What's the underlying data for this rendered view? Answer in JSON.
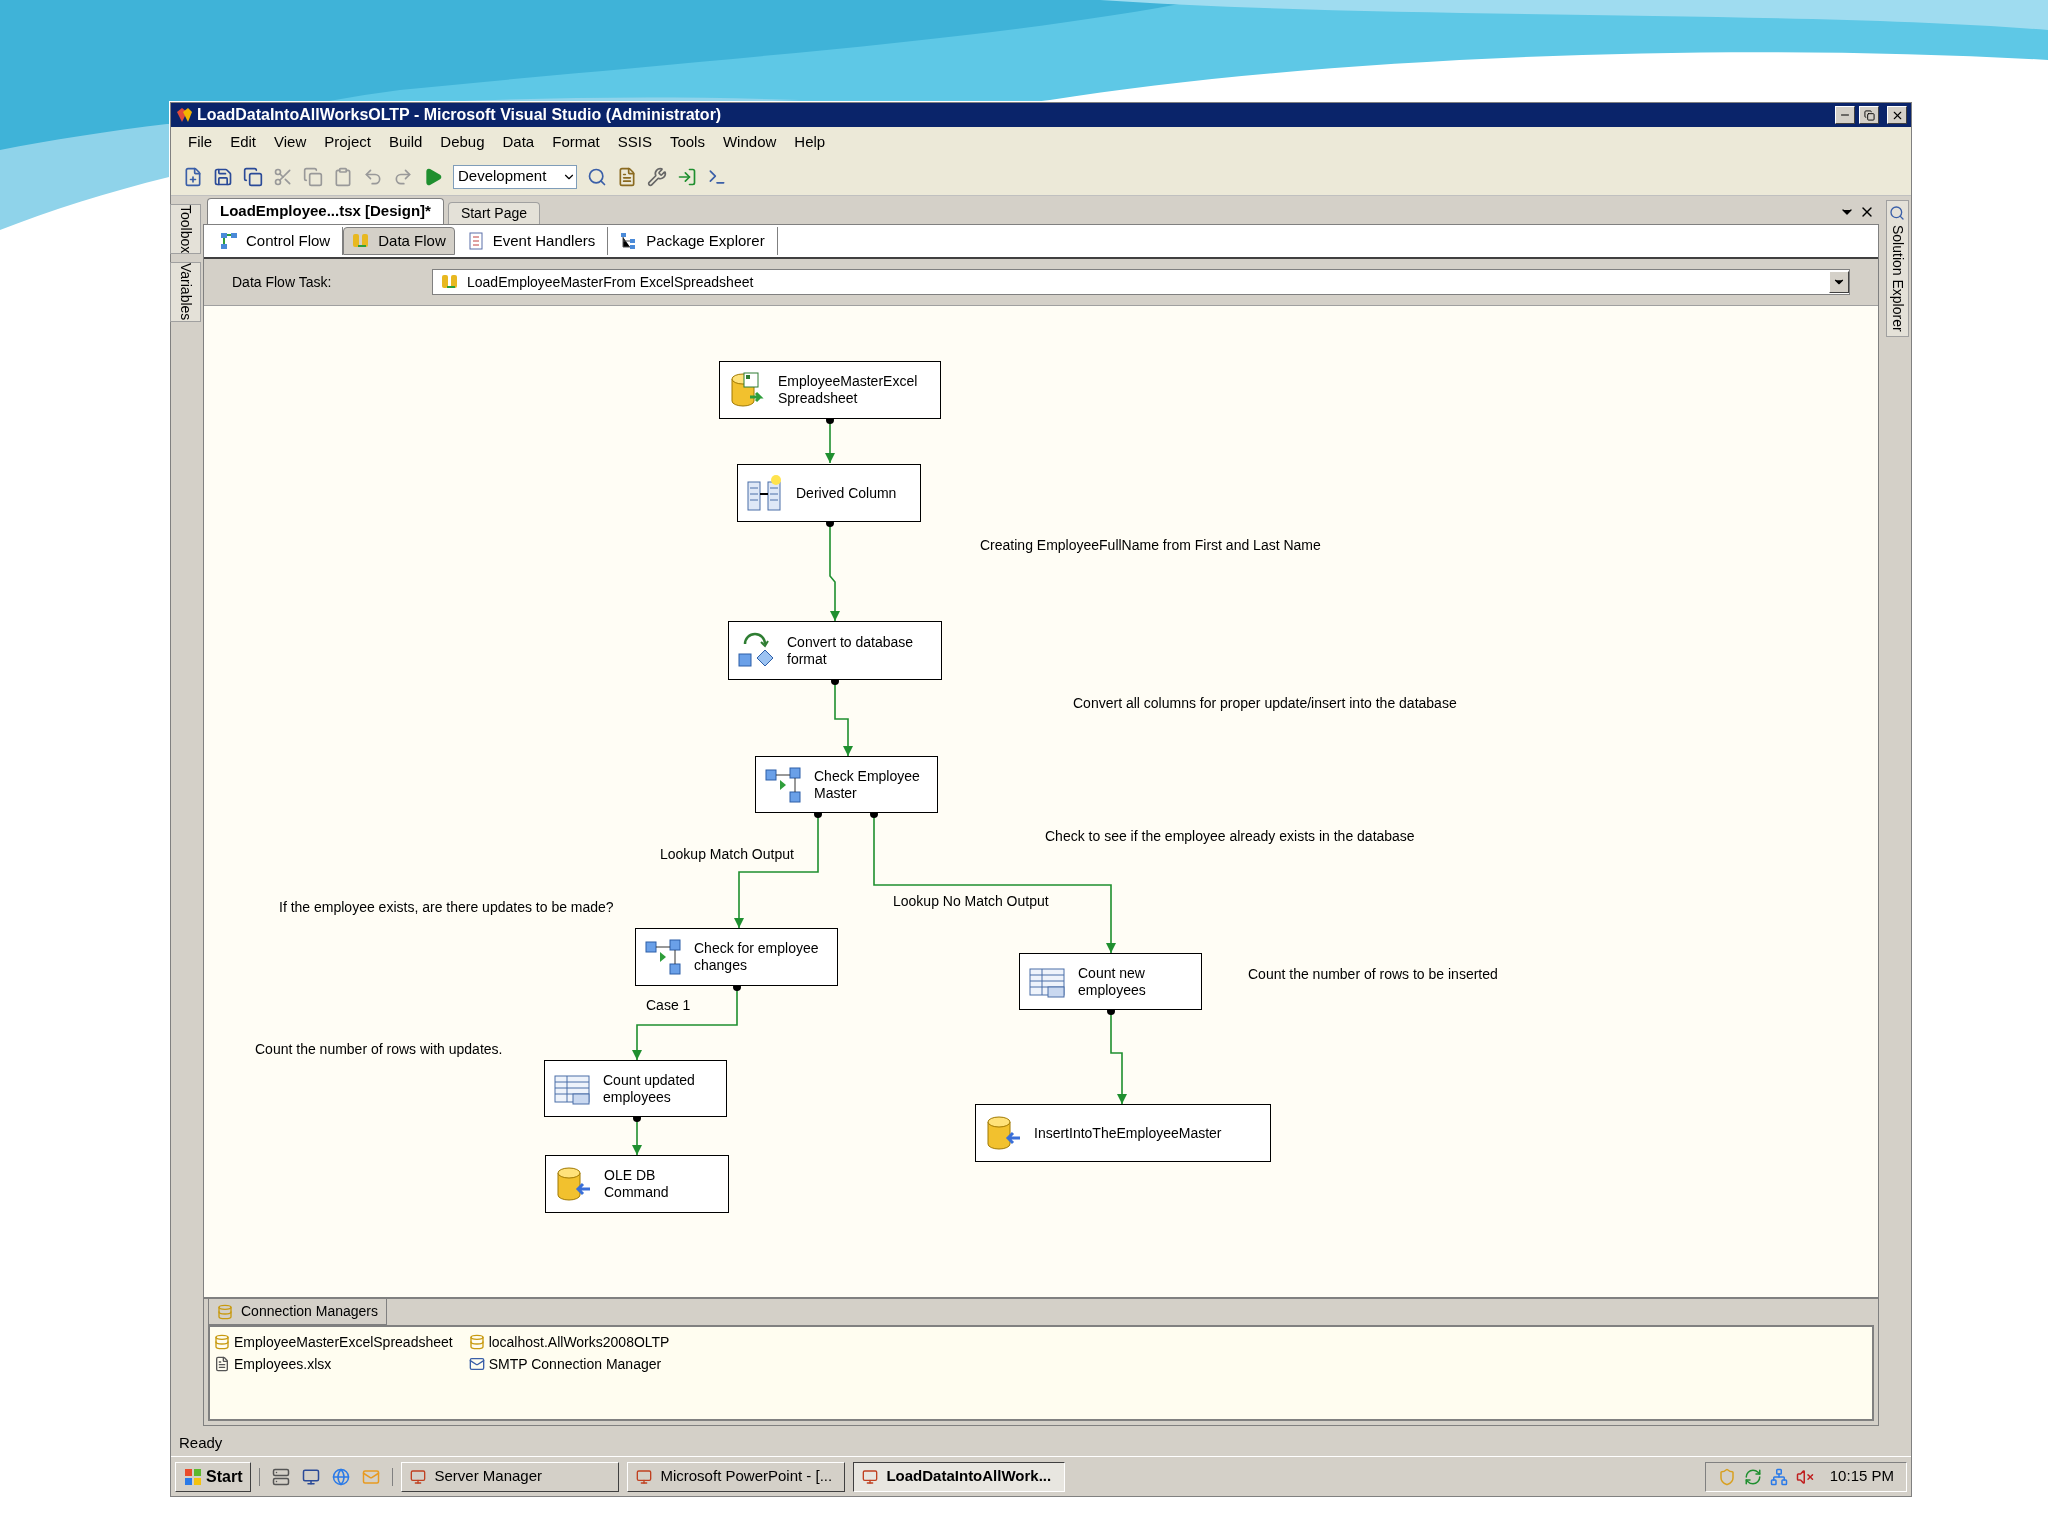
{
  "window": {
    "title": "LoadDataIntoAllWorksOLTP - Microsoft Visual Studio (Administrator)"
  },
  "menu": [
    "File",
    "Edit",
    "View",
    "Project",
    "Build",
    "Debug",
    "Data",
    "Format",
    "SSIS",
    "Tools",
    "Window",
    "Help"
  ],
  "toolbar": {
    "configuration": "Development"
  },
  "left_panels": [
    "Toolbox",
    "Variables"
  ],
  "right_panels": [
    "Solution Explorer"
  ],
  "document_tabs": [
    {
      "label": "LoadEmployee...tsx [Design]*",
      "selected": true
    },
    {
      "label": "Start Page",
      "selected": false
    }
  ],
  "designer_tabs": [
    {
      "label": "Control Flow",
      "selected": false,
      "kind": "control"
    },
    {
      "label": "Data Flow",
      "selected": true,
      "kind": "data"
    },
    {
      "label": "Event Handlers",
      "selected": false,
      "kind": "events"
    },
    {
      "label": "Package Explorer",
      "selected": false,
      "kind": "explorer"
    }
  ],
  "task_selector": {
    "label": "Data Flow Task:",
    "value": "LoadEmployeeMasterFrom ExcelSpreadsheet"
  },
  "components": [
    {
      "label": "EmployeeMasterExcel Spreadsheet",
      "kind": "source"
    },
    {
      "label": "Derived Column",
      "kind": "derived"
    },
    {
      "label": "Convert to database format",
      "kind": "convert"
    },
    {
      "label": "Check Employee Master",
      "kind": "lookup"
    },
    {
      "label": "Check for employee changes",
      "kind": "split"
    },
    {
      "label": "Count new employees",
      "kind": "rowcount"
    },
    {
      "label": "Count updated employees",
      "kind": "rowcount"
    },
    {
      "label": "OLE DB Command",
      "kind": "command"
    },
    {
      "label": "InsertIntoTheEmployeeMaster",
      "kind": "destination"
    }
  ],
  "path_labels": [
    "Lookup Match Output",
    "Lookup No Match Output",
    "Case 1"
  ],
  "annotations": [
    "Creating EmployeeFullName from First and Last Name",
    "Convert all columns for proper update/insert into the database",
    "Check to see if the employee already exists in the database",
    "If the employee exists, are there updates to be made?",
    "Count the number of rows to be inserted",
    "Count the number of rows with updates."
  ],
  "connection_managers": {
    "title": "Connection Managers",
    "items": [
      {
        "label": "EmployeeMasterExcelSpreadsheet",
        "kind": "excel"
      },
      {
        "label": "localhost.AllWorks2008OLTP",
        "kind": "oledb"
      },
      {
        "label": "Employees.xlsx",
        "kind": "file"
      },
      {
        "label": "SMTP Connection Manager",
        "kind": "smtp"
      }
    ]
  },
  "status_bar": "Ready",
  "taskbar": {
    "start": "Start",
    "tasks": [
      {
        "label": "Server Manager",
        "selected": false
      },
      {
        "label": "Microsoft PowerPoint - [...",
        "selected": false
      },
      {
        "label": "LoadDataIntoAllWork...",
        "selected": true
      }
    ],
    "clock": "10:15 PM"
  }
}
